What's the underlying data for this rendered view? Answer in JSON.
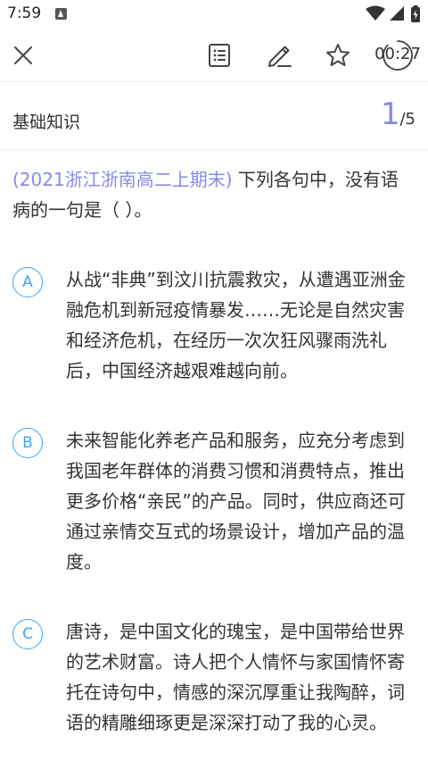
{
  "status_bar": {
    "time": "7:59",
    "icons": [
      "notification-icon",
      "wifi-icon",
      "signal-icon",
      "battery-icon"
    ]
  },
  "toolbar": {
    "icons": [
      "close-icon",
      "answer-sheet-icon",
      "edit-icon",
      "star-icon",
      "timer-icon"
    ],
    "timer": "00:27"
  },
  "section": {
    "title": "基础知识",
    "current": "1",
    "separator": "/",
    "total": "5"
  },
  "question": {
    "source": "(2021浙江浙南高二上期末)",
    "text": " 下列各句中，没有语病的一句是（  ）。"
  },
  "options": [
    {
      "letter": "A",
      "text": "从战“非典”到汶川抗震救灾，从遭遇亚洲金融危机到新冠疫情暴发……无论是自然灾害和经济危机，在经历一次次狂风骤雨洗礼后，中国经济越艰难越向前。"
    },
    {
      "letter": "B",
      "text": "未来智能化养老产品和服务，应充分考虑到我国老年群体的消费习惯和消费特点，推出更多价格“亲民”的产品。同时，供应商还可通过亲情交互式的场景设计，增加产品的温度。"
    },
    {
      "letter": "C",
      "text": "唐诗，是中国文化的瑰宝，是中国带给世界的艺术财富。诗人把个人情怀与家国情怀寄托在诗句中，情感的深沉厚重让我陶醉，词语的精雕细琢更是深深打动了我的心灵。"
    }
  ],
  "colors": {
    "accent_purple": "#8a8ae6",
    "option_blue": "#3da4ef",
    "text": "#333333",
    "divider": "#eeeeee"
  }
}
